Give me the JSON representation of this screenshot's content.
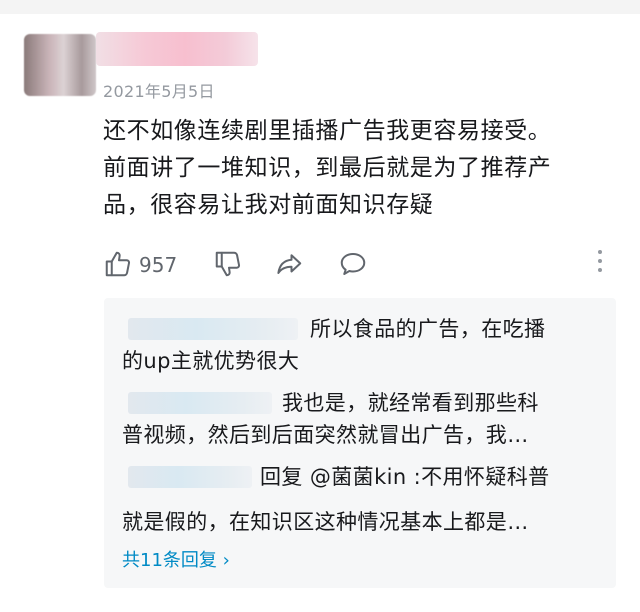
{
  "comment": {
    "date": "2021年5月5日",
    "lines": [
      "还不如像连续剧里插播广告我更容易接受。",
      "前面讲了一堆知识，到最后就是为了推荐产",
      "品，很容易让我对前面知识存疑"
    ],
    "like_count": "957",
    "icons": [
      "thumbs-up-icon",
      "thumbs-down-icon",
      "share-icon",
      "reply-bubble-icon",
      "more-vertical-icon"
    ]
  },
  "replies": {
    "items": [
      {
        "line1": "所以食品的广告，在吃播",
        "line2": "的up主就优势很大"
      },
      {
        "line1": "我也是，就经常看到那些科",
        "line2": "普视频，然后到后面突然就冒出广告，我…"
      },
      {
        "line1": "回复 @菌菌kin :不用怀疑科普",
        "line2": "就是假的，在知识区这种情况基本上都是…"
      }
    ],
    "more_link": "共11条回复 ›"
  }
}
